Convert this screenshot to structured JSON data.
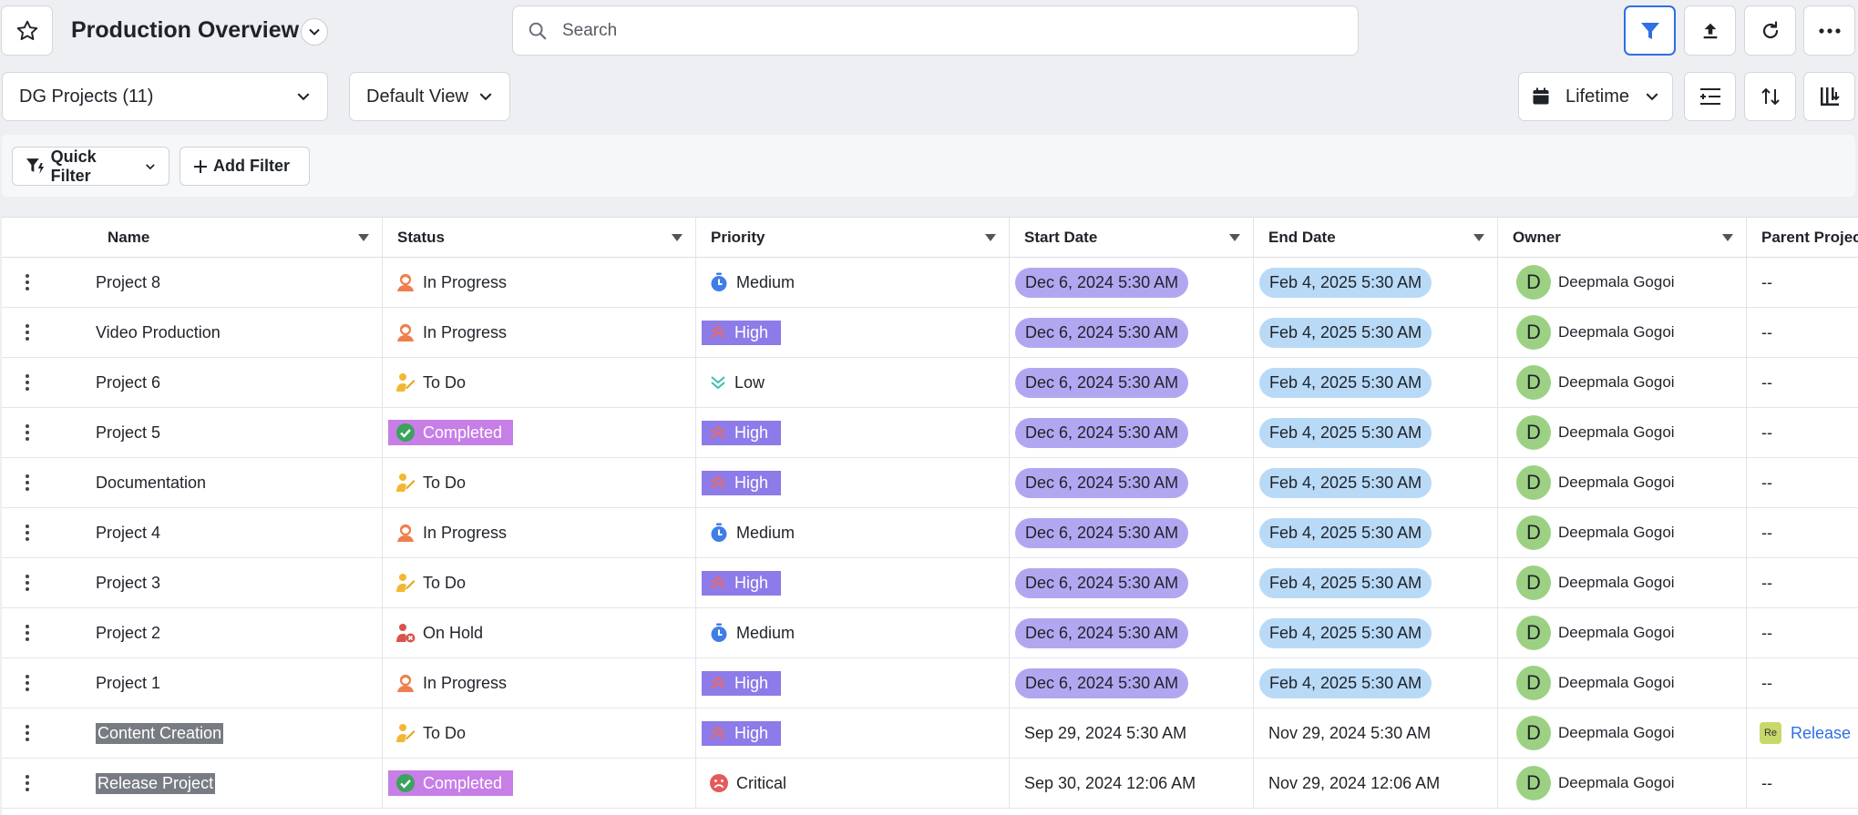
{
  "header": {
    "title": "Production Overview",
    "search_placeholder": "Search"
  },
  "toolbar": {
    "project_selector": "DG Projects (11)",
    "view_selector": "Default View",
    "date_range": "Lifetime"
  },
  "filters": {
    "quick_filter": "Quick Filter",
    "add_filter": "Add Filter"
  },
  "columns": [
    "Name",
    "Status",
    "Priority",
    "Start Date",
    "End Date",
    "Owner",
    "Parent Project"
  ],
  "rows": [
    {
      "name": "Project 8",
      "status": "In Progress",
      "status_icon": "in-progress",
      "priority": "Medium",
      "start": "Dec 6, 2024 5:30 AM",
      "end": "Feb 4, 2025 5:30 AM",
      "owner_initial": "D",
      "owner": "Deepmala Gogoi",
      "parent": "--"
    },
    {
      "name": "Video Production",
      "status": "In Progress",
      "status_icon": "in-progress",
      "priority": "High",
      "start": "Dec 6, 2024 5:30 AM",
      "end": "Feb 4, 2025 5:30 AM",
      "owner_initial": "D",
      "owner": "Deepmala Gogoi",
      "parent": "--"
    },
    {
      "name": "Project 6",
      "status": "To Do",
      "status_icon": "to-do",
      "priority": "Low",
      "start": "Dec 6, 2024 5:30 AM",
      "end": "Feb 4, 2025 5:30 AM",
      "owner_initial": "D",
      "owner": "Deepmala Gogoi",
      "parent": "--"
    },
    {
      "name": "Project 5",
      "status": "Completed",
      "status_icon": "completed",
      "priority": "High",
      "start": "Dec 6, 2024 5:30 AM",
      "end": "Feb 4, 2025 5:30 AM",
      "owner_initial": "D",
      "owner": "Deepmala Gogoi",
      "parent": "--"
    },
    {
      "name": "Documentation",
      "status": "To Do",
      "status_icon": "to-do",
      "priority": "High",
      "start": "Dec 6, 2024 5:30 AM",
      "end": "Feb 4, 2025 5:30 AM",
      "owner_initial": "D",
      "owner": "Deepmala Gogoi",
      "parent": "--"
    },
    {
      "name": "Project 4",
      "status": "In Progress",
      "status_icon": "in-progress",
      "priority": "Medium",
      "start": "Dec 6, 2024 5:30 AM",
      "end": "Feb 4, 2025 5:30 AM",
      "owner_initial": "D",
      "owner": "Deepmala Gogoi",
      "parent": "--"
    },
    {
      "name": "Project 3",
      "status": "To Do",
      "status_icon": "to-do",
      "priority": "High",
      "start": "Dec 6, 2024 5:30 AM",
      "end": "Feb 4, 2025 5:30 AM",
      "owner_initial": "D",
      "owner": "Deepmala Gogoi",
      "parent": "--"
    },
    {
      "name": "Project 2",
      "status": "On Hold",
      "status_icon": "on-hold",
      "priority": "Medium",
      "start": "Dec 6, 2024 5:30 AM",
      "end": "Feb 4, 2025 5:30 AM",
      "owner_initial": "D",
      "owner": "Deepmala Gogoi",
      "parent": "--"
    },
    {
      "name": "Project 1",
      "status": "In Progress",
      "status_icon": "in-progress",
      "priority": "High",
      "start": "Dec 6, 2024 5:30 AM",
      "end": "Feb 4, 2025 5:30 AM",
      "owner_initial": "D",
      "owner": "Deepmala Gogoi",
      "parent": "--"
    },
    {
      "name": "Content Creation",
      "status": "To Do",
      "status_icon": "to-do",
      "priority": "High",
      "start": "Sep 29, 2024 5:30 AM",
      "end": "Nov 29, 2024 5:30 AM",
      "owner_initial": "D",
      "owner": "Deepmala Gogoi",
      "parent": "Release",
      "parent_badge": "Re"
    },
    {
      "name": "Release Project",
      "status": "Completed",
      "status_icon": "completed",
      "priority": "Critical",
      "start": "Sep 30, 2024 12:06 AM",
      "end": "Nov 29, 2024 12:06 AM",
      "owner_initial": "D",
      "owner": "Deepmala Gogoi",
      "parent": "--"
    }
  ],
  "colors": {
    "accent": "#2f6fe4",
    "completed": "#c77ee6",
    "high": "#8c7be8",
    "start_pill": "#b1a7f1",
    "end_pill": "#b9daf7",
    "avatar": "#9cd184"
  }
}
